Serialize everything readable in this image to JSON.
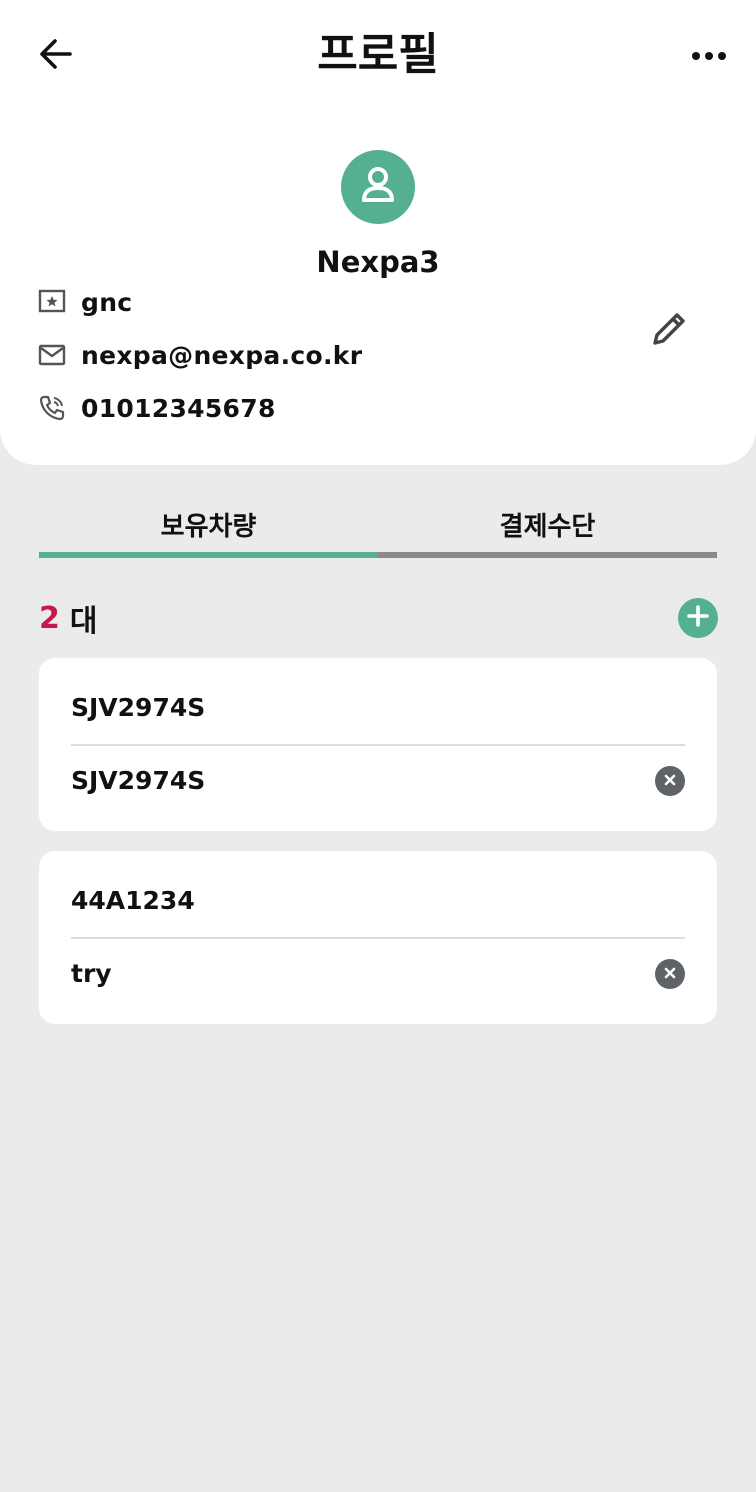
{
  "header": {
    "title": "프로필",
    "back_icon": "arrow-left-icon",
    "more_icon": "more-horizontal-icon"
  },
  "profile": {
    "avatar_icon": "user-avatar-icon",
    "name": "Nexpa3",
    "company": "gnc",
    "email": "nexpa@nexpa.co.kr",
    "phone": "01012345678",
    "edit_icon": "pencil-icon"
  },
  "tabs": [
    {
      "label": "보유차량",
      "active": true
    },
    {
      "label": "결제수단",
      "active": false
    }
  ],
  "vehicles": {
    "count": "2",
    "unit": "대",
    "items": [
      {
        "plate": "SJV2974S",
        "name": "SJV2974S"
      },
      {
        "plate": "44A1234",
        "name": "try"
      }
    ]
  },
  "colors": {
    "accent": "#54b08e",
    "count_highlight": "#c4194a",
    "background": "#ebebeb",
    "card": "#ffffff",
    "inactive_tab": "#8a8a8a",
    "delete_button": "#5f6266"
  }
}
